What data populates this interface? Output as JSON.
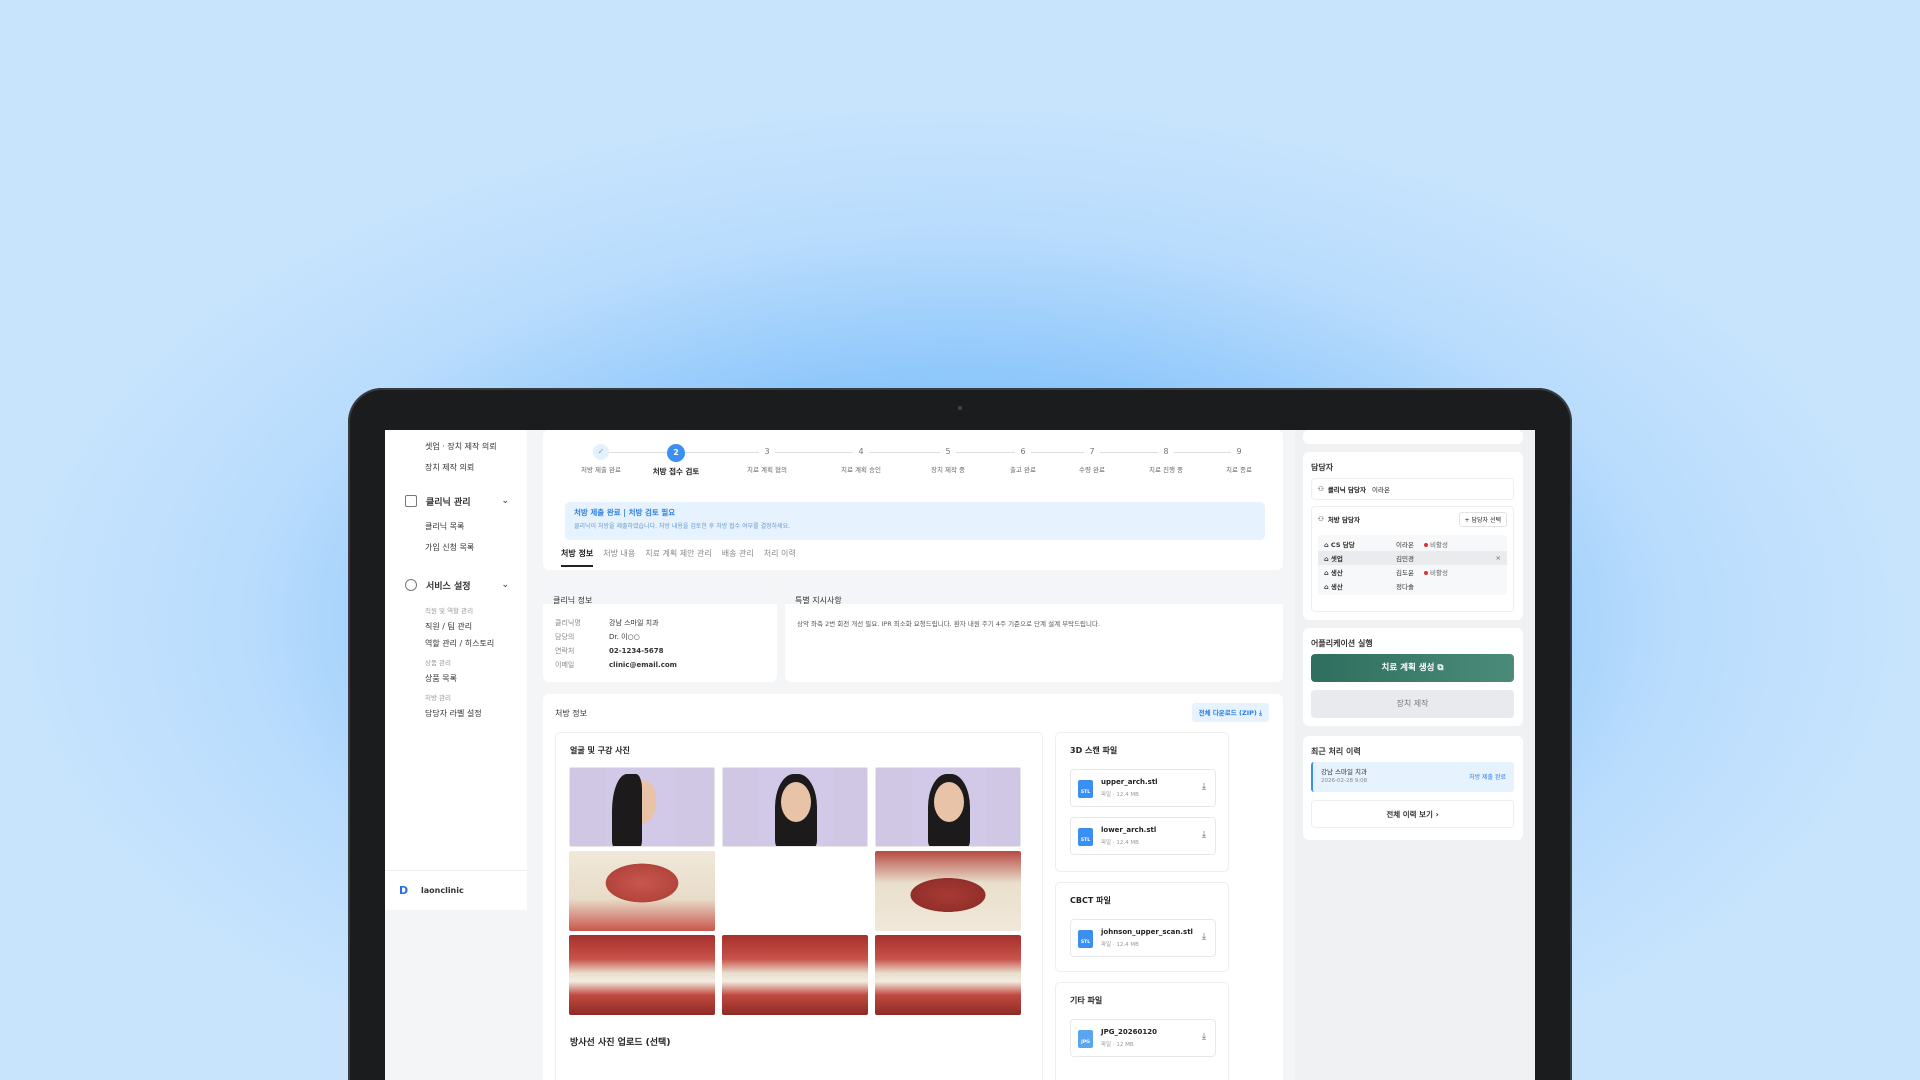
{
  "sidebar": {
    "top_items": [
      "셋업 · 장치 제작 의뢰",
      "장치 제작 의뢰"
    ],
    "groups": [
      {
        "label": "클리닉 관리",
        "items": [
          "클리닉 목록",
          "가입 신청 목록"
        ]
      },
      {
        "label": "서비스 설정"
      }
    ],
    "service_sections": [
      {
        "category": "직원 및 역할 관리",
        "items": [
          "직원 / 팀 관리",
          "역할 관리 / 히스토리"
        ]
      },
      {
        "category": "상품 관리",
        "items": [
          "상품 목록"
        ]
      },
      {
        "category": "처방 관리",
        "items": [
          "담당자 라벨 설정"
        ]
      }
    ],
    "footer": {
      "logo": "D",
      "name": "laonclinic"
    }
  },
  "stepper": {
    "steps": [
      {
        "num": "✓",
        "label": "처방 제출 완료"
      },
      {
        "num": "2",
        "label": "처방 접수 검토"
      },
      {
        "num": "3",
        "label": "치료 계획 협의"
      },
      {
        "num": "4",
        "label": "치료 계획 승인"
      },
      {
        "num": "5",
        "label": "장치 제작 중"
      },
      {
        "num": "6",
        "label": "출고 완료"
      },
      {
        "num": "7",
        "label": "수령 완료"
      },
      {
        "num": "8",
        "label": "치료 진행 중"
      },
      {
        "num": "9",
        "label": "치료 종료"
      }
    ],
    "current": 2
  },
  "notice": {
    "title": "처방 제출 완료 | 처방 검토 필요",
    "desc": "클리닉이 처방을 제출하였습니다. 처방 내용을 검토한 후 처방 접수 여부를 결정하세요."
  },
  "tabs": [
    "처방 정보",
    "처방 내용",
    "치료 계획 제안 관리",
    "배송 관리",
    "처리 이력"
  ],
  "clinic_info": {
    "title": "클리닉 정보",
    "rows": [
      {
        "k": "클리닉명",
        "v": "강남 스마일 치과"
      },
      {
        "k": "담당의",
        "v": "Dr. 이○○"
      },
      {
        "k": "연락처",
        "v": "02-1234-5678"
      },
      {
        "k": "이메일",
        "v": "clinic@email.com"
      }
    ]
  },
  "special": {
    "title": "특별 지시사항",
    "text": "상악 좌측 2번 회전 개선 필요. IPR 최소화 요청드립니다. 환자 내원 주기 4주 기준으로 단계 설계 부탁드립니다."
  },
  "prescription": {
    "title": "처방 정보",
    "download_label": "전체 다운로드 (ZIP)",
    "photos_title": "얼굴 및 구강 사진",
    "xray_title": "방사선 사진 업로드 (선택)"
  },
  "files": {
    "scan_title": "3D 스캔 파일",
    "scan": [
      {
        "type": "STL",
        "name": "upper_arch.stl",
        "meta": "파일 · 12.4 MB"
      },
      {
        "type": "STL",
        "name": "lower_arch.stl",
        "meta": "파일 · 12.4 MB"
      }
    ],
    "cbct_title": "CBCT 파일",
    "cbct": [
      {
        "type": "STL",
        "name": "johnson_upper_scan.stl",
        "meta": "파일 · 12.4 MB"
      }
    ],
    "other_title": "기타 파일",
    "other": [
      {
        "type": "JPG",
        "name": "JPG_20260120",
        "meta": "파일 · 12 MB"
      }
    ]
  },
  "right": {
    "manager_title": "담당자",
    "clinic_manager_label": "클리닉 담당자",
    "clinic_manager_name": "이라온",
    "rx_manager_label": "처방 담당자",
    "select_btn": "+ 담당자 선택",
    "assignees": [
      {
        "tag": "CS 담당",
        "name": "이라온",
        "status": "비활성"
      },
      {
        "tag": "셋업",
        "name": "김민경",
        "status": "",
        "remove": "×"
      },
      {
        "tag": "생산",
        "name": "김도윤",
        "status": "비활성"
      },
      {
        "tag": "생산",
        "name": "정다솔",
        "status": ""
      }
    ],
    "app_title": "어플리케이션 실행",
    "btn_plan": "치료 계획 생성",
    "btn_device": "장치 제작",
    "history_title": "최근 처리 이력",
    "history": [
      {
        "clinic": "강남 스마일 치과",
        "date": "2026-02-28 9:08",
        "status": "처방 제출 완료"
      }
    ],
    "history_all": "전체 이력 보기"
  }
}
